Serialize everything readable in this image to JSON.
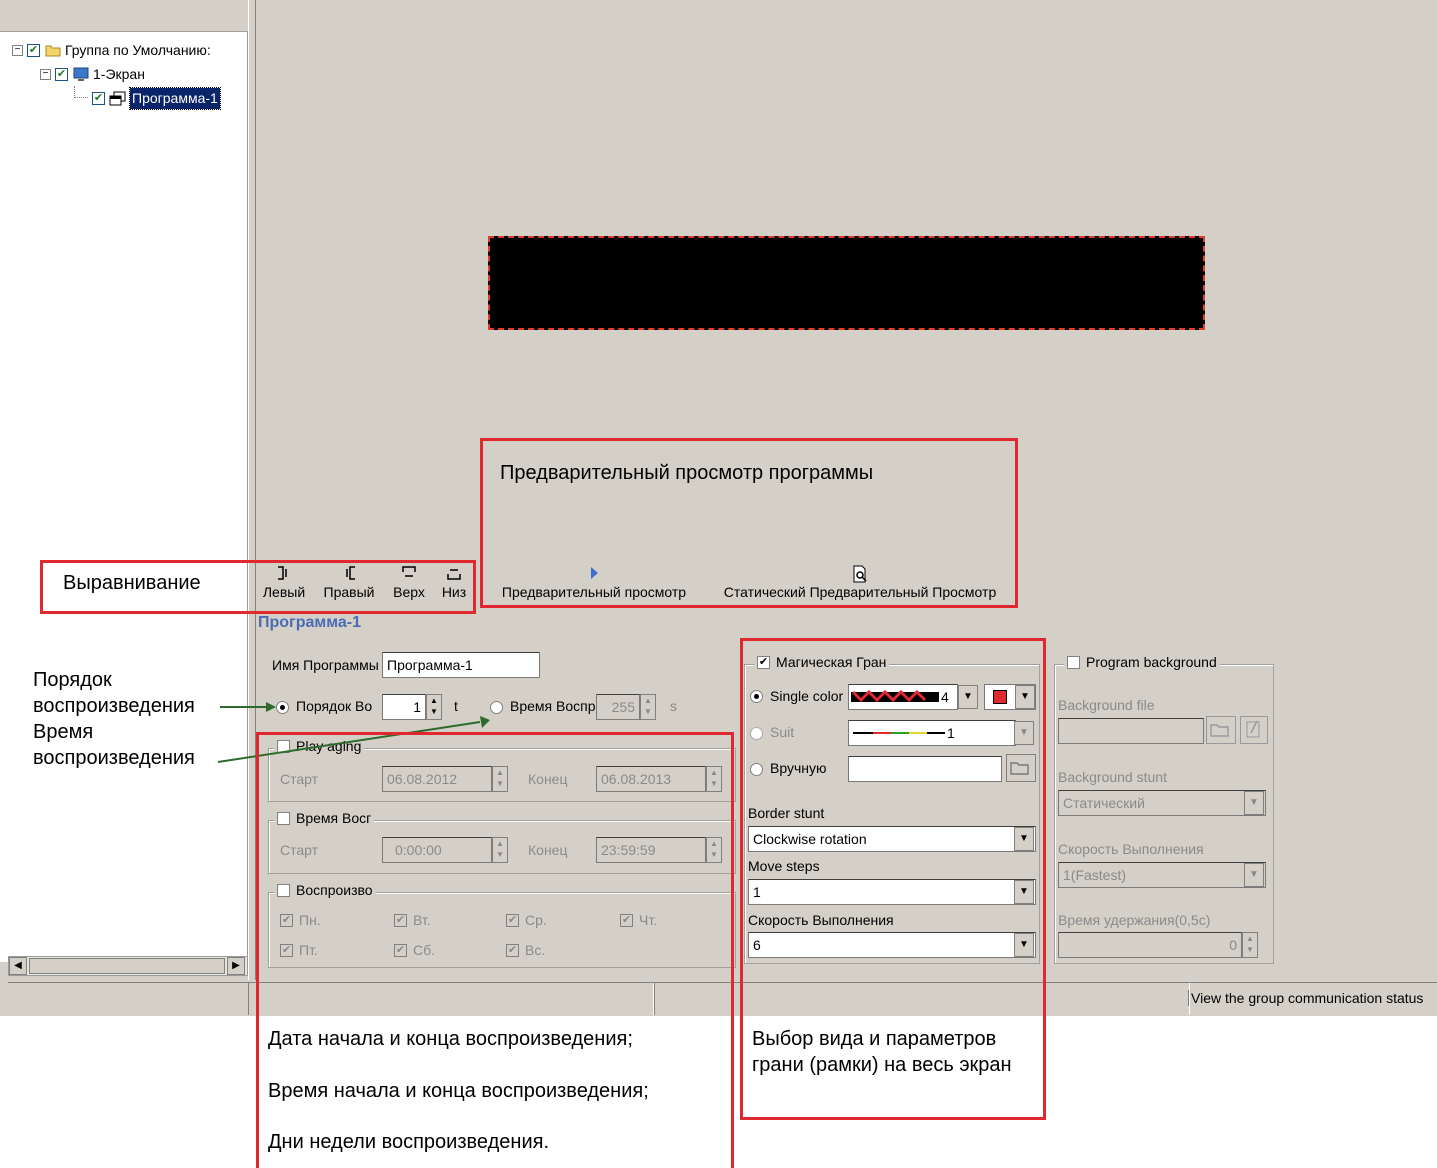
{
  "tree": {
    "group_label": "Группа по Умолчанию:",
    "screen_label": "1-Экран",
    "program_label": "Программа-1"
  },
  "preview": {
    "annotation": "Предварительный просмотр программы"
  },
  "toolbar": {
    "align_annotation": "Выравнивание",
    "left": "Левый",
    "right": "Правый",
    "top": "Верх",
    "bottom": "Низ",
    "preview": "Предварительный просмотр",
    "static_preview": "Статический Предварительный Просмотр"
  },
  "program": {
    "section_title": "Программа-1",
    "name_label": "Имя Программы",
    "name_value": "Программа-1",
    "order_label": "Порядок Во",
    "order_value": "1",
    "order_unit": "t",
    "time_label": "Время Воспр",
    "time_value": "255",
    "time_unit": "s",
    "play_aging": {
      "title": "Play aging",
      "start_label": "Старт",
      "start_value": "06.08.2012",
      "end_label": "Конец",
      "end_value": "06.08.2013"
    },
    "play_time": {
      "title": "Время Восг",
      "start_label": "Старт",
      "start_value": "0:00:00",
      "end_label": "Конец",
      "end_value": "23:59:59"
    },
    "weekdays": {
      "title": "Воспроизво",
      "days": [
        "Пн.",
        "Вт.",
        "Ср.",
        "Чт.",
        "Пт.",
        "Сб.",
        "Вс."
      ]
    }
  },
  "border": {
    "title": "Магическая Гран",
    "single_color": "Single color",
    "single_value": "4",
    "suit": "Suit",
    "suit_value": "1",
    "manual": "Вручную",
    "stunt_label": "Border stunt",
    "stunt_value": "Clockwise rotation",
    "steps_label": "Move steps",
    "steps_value": "1",
    "speed_label": "Скорость Выполнения",
    "speed_value": "6",
    "accent_color": "#e0292f"
  },
  "background": {
    "title": "Program background",
    "file_label": "Background file",
    "stunt_label": "Background stunt",
    "stunt_value": "Статический",
    "speed_label": "Скорость Выполнения",
    "speed_value": "1(Fastest)",
    "hold_label": "Время удержания(0,5с)",
    "hold_value": "0"
  },
  "status": {
    "right_text": "View the group communication status"
  },
  "annotations": {
    "order_line1": "Порядок",
    "order_line2": "воспроизведения",
    "time_line1": "Время",
    "time_line2": "воспроизведения",
    "dates_note1": "Дата начала и конца воспроизведения;",
    "dates_note2": "Время начала и конца воспроизведения;",
    "dates_note3": "Дни недели воспроизведения.",
    "border_note1": "Выбор вида и параметров",
    "border_note2": "грани (рамки) на весь экран"
  }
}
